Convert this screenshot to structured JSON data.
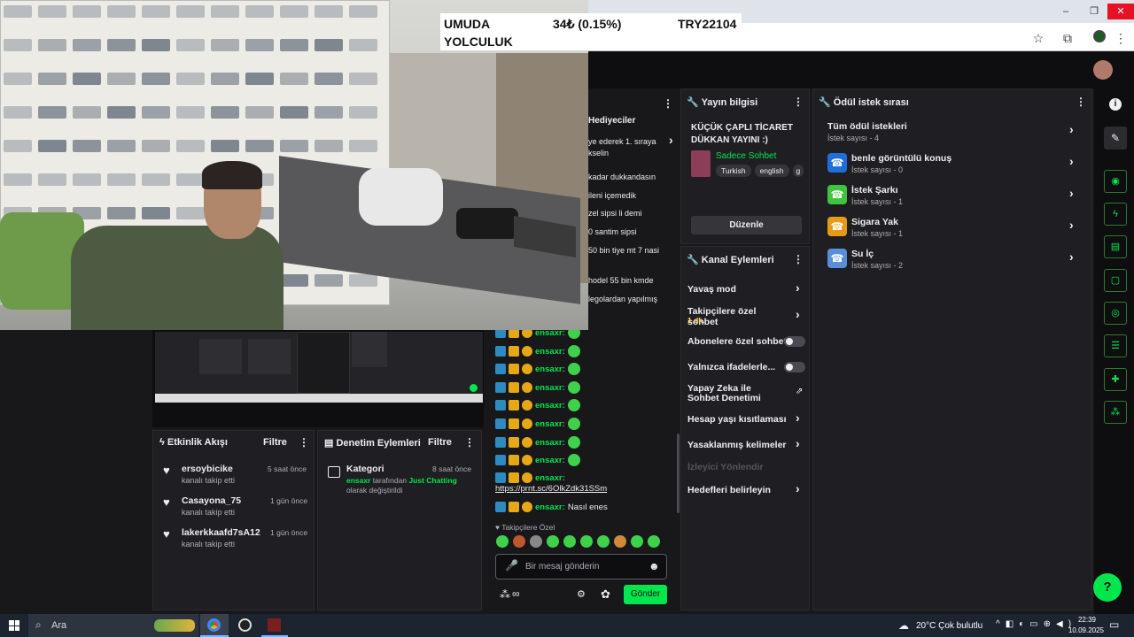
{
  "ticker": {
    "left_line1": "UMUDA",
    "left_line2": "YOLCULUK",
    "middle": "34₺ (0.15%)",
    "right": "TRY22104"
  },
  "window_controls": {
    "minimize": "–",
    "maximize": "❐",
    "close": "✕"
  },
  "browser_toolbar": {
    "bookmark_icon": "star-icon",
    "extensions_icon": "puzzle-icon",
    "menu_icon": "⋮"
  },
  "partial_chat_top": [
    "Hediyeciler",
    "ye ederek 1. sıraya",
    "kselin",
    "kadar dukkandasın",
    "ileni içemedik",
    "zel sipsi li demi",
    "0 santim sipsi",
    "50 bin tiye mt 7 nasi",
    "hodel 55 bin kmde",
    "legolardan yapılmış"
  ],
  "stream_info": {
    "title": "Yayın bilgisi",
    "stream_title": "KÜÇÜK ÇAPLI TİCARET DÜKKAN YAYINI :)",
    "category": "Sadece Sohbet",
    "tags": [
      "Turkish",
      "english",
      "g"
    ],
    "edit_button": "Düzenle"
  },
  "channel_actions": {
    "title": "Kanal Eylemleri",
    "items": [
      {
        "label": "Yavaş mod",
        "type": "chevron"
      },
      {
        "label": "Takipçilere özel sohbet",
        "sub": "1 dk.",
        "type": "chevron"
      },
      {
        "label": "Abonelere özel sohbet",
        "type": "toggle"
      },
      {
        "label": "Yalnızca ifadelerle...",
        "type": "toggle"
      },
      {
        "label": "Yapay Zeka ile Sohbet Denetimi",
        "type": "external"
      },
      {
        "label": "Hesap yaşı kısıtlaması",
        "type": "chevron"
      },
      {
        "label": "Yasaklanmış kelimeler",
        "type": "chevron"
      },
      {
        "label": "İzleyici Yönlendir",
        "type": "disabled"
      },
      {
        "label": "Hedefleri belirleyin",
        "type": "chevron"
      }
    ]
  },
  "reward_queue": {
    "title": "Ödül istek sırası",
    "all_title": "Tüm ödül istekleri",
    "all_sub": "İstek sayısı - 4",
    "rewards": [
      {
        "name": "benle görüntülü konuş",
        "count": "İstek sayısı - 0",
        "color": "#1e6fd9"
      },
      {
        "name": "İstek Şarkı",
        "count": "İstek sayısı - 1",
        "color": "#3fc43f"
      },
      {
        "name": "Sigara Yak",
        "count": "İstek sayısı - 1",
        "color": "#e69a17"
      },
      {
        "name": "Su İç",
        "count": "İstek sayısı - 2",
        "color": "#5a8fd8"
      }
    ]
  },
  "chat": {
    "username": "ensaxr",
    "messages": [
      {
        "user": "ensaxr:",
        "text": ""
      },
      {
        "user": "ensaxr:",
        "text": ""
      },
      {
        "user": "ensaxr:",
        "text": ""
      },
      {
        "user": "ensaxr:",
        "text": ""
      },
      {
        "user": "ensaxr:",
        "text": ""
      },
      {
        "user": "ensaxr:",
        "text": ""
      },
      {
        "user": "ensaxr:",
        "text": ""
      },
      {
        "user": "ensaxr:",
        "text": ""
      }
    ],
    "link_user": "ensaxr:",
    "link": "https://prnt.sc/6OlkZdk31SSm",
    "last_user": "ensaxr:",
    "last_text": "Nasıl enes",
    "followers_only_label": "Takipçilere Özel",
    "input_placeholder": "Bir mesaj gönderin",
    "points": "∞",
    "send_button": "Gönder"
  },
  "activity_feed": {
    "title": "Etkinlik Akışı",
    "filter": "Filtre",
    "events": [
      {
        "user": "ersoybicike",
        "action": "kanalı takip etti",
        "time": "5 saat önce"
      },
      {
        "user": "Casayona_75",
        "action": "kanalı takip etti",
        "time": "1 gün önce"
      },
      {
        "user": "lakerkkaafd7sA12",
        "action": "kanalı takip etti",
        "time": "1 gün önce"
      }
    ]
  },
  "mod_actions": {
    "title": "Denetim Eylemleri",
    "filter": "Filtre",
    "entry_title": "Kategori",
    "entry_time": "8 saat önce",
    "entry_user": "ensaxr",
    "entry_mid": "tarafından",
    "entry_category": "Just Chatting",
    "entry_end": "olarak değiştirildi"
  },
  "taskbar": {
    "search": "Ara",
    "weather": "20°C  Çok bulutlu",
    "time": "22:39",
    "date": "10.09.2025"
  }
}
